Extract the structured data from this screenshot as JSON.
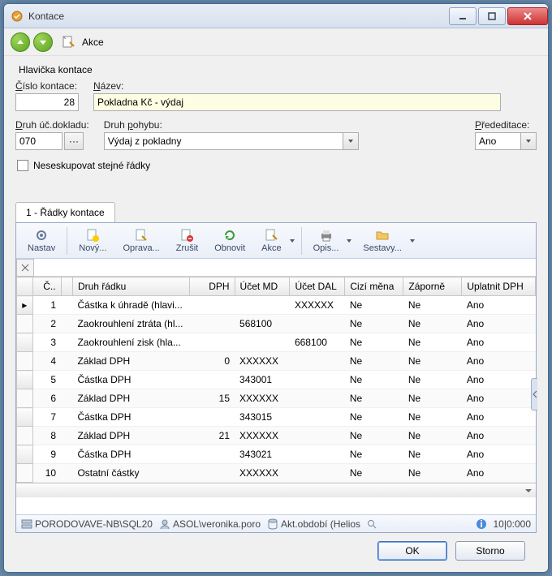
{
  "window": {
    "title": "Kontace"
  },
  "win_btns": {
    "min": "minimize",
    "max": "maximize",
    "close": "close"
  },
  "topbar": {
    "akce": "Akce"
  },
  "header": {
    "section_title": "Hlavička kontace",
    "cislo_label": "Číslo kontace:",
    "cislo_value": "28",
    "nazev_label": "Název:",
    "nazev_value": "Pokladna Kč - výdaj",
    "druh_dokladu_label": "Druh úč.dokladu:",
    "druh_dokladu_value": "070",
    "druh_pohybu_label": "Druh pohybu:",
    "druh_pohybu_value": "Výdaj z pokladny",
    "prededitace_label": "Přededitace:",
    "prededitace_value": "Ano",
    "neseskupovat_label": "Neseskupovat stejné řádky"
  },
  "tabs": {
    "tab1": "1 - Řádky kontace"
  },
  "toolbar": {
    "nastav": "Nastav",
    "novy": "Nový...",
    "oprava": "Oprava...",
    "zrusit": "Zrušit",
    "obnovit": "Obnovit",
    "akce": "Akce",
    "opis": "Opis...",
    "sestavy": "Sestavy..."
  },
  "grid": {
    "columns": {
      "cislo": "Č..",
      "druh": "Druh řádku",
      "dph": "DPH",
      "md": "Účet MD",
      "dal": "Účet DAL",
      "cizi": "Cizí měna",
      "zaporne": "Záporně",
      "uplatnit": "Uplatnit DPH"
    },
    "rows": [
      {
        "c": "1",
        "druh": "Částka k úhradě (hlavi...",
        "dph": "",
        "md": "",
        "dal": "XXXXXX",
        "cizi": "Ne",
        "zap": "Ne",
        "upl": "Ano"
      },
      {
        "c": "2",
        "druh": "Zaokrouhlení ztráta (hl...",
        "dph": "",
        "md": "568100",
        "dal": "",
        "cizi": "Ne",
        "zap": "Ne",
        "upl": "Ano"
      },
      {
        "c": "3",
        "druh": "Zaokrouhlení zisk (hla...",
        "dph": "",
        "md": "",
        "dal": "668100",
        "cizi": "Ne",
        "zap": "Ne",
        "upl": "Ano"
      },
      {
        "c": "4",
        "druh": "Základ DPH",
        "dph": "0",
        "md": "XXXXXX",
        "dal": "",
        "cizi": "Ne",
        "zap": "Ne",
        "upl": "Ano"
      },
      {
        "c": "5",
        "druh": "Částka DPH",
        "dph": "",
        "md": "343001",
        "dal": "",
        "cizi": "Ne",
        "zap": "Ne",
        "upl": "Ano"
      },
      {
        "c": "6",
        "druh": "Základ DPH",
        "dph": "15",
        "md": "XXXXXX",
        "dal": "",
        "cizi": "Ne",
        "zap": "Ne",
        "upl": "Ano"
      },
      {
        "c": "7",
        "druh": "Částka DPH",
        "dph": "",
        "md": "343015",
        "dal": "",
        "cizi": "Ne",
        "zap": "Ne",
        "upl": "Ano"
      },
      {
        "c": "8",
        "druh": "Základ DPH",
        "dph": "21",
        "md": "XXXXXX",
        "dal": "",
        "cizi": "Ne",
        "zap": "Ne",
        "upl": "Ano"
      },
      {
        "c": "9",
        "druh": "Částka DPH",
        "dph": "",
        "md": "343021",
        "dal": "",
        "cizi": "Ne",
        "zap": "Ne",
        "upl": "Ano"
      },
      {
        "c": "10",
        "druh": "Ostatní částky",
        "dph": "",
        "md": "XXXXXX",
        "dal": "",
        "cizi": "Ne",
        "zap": "Ne",
        "upl": "Ano"
      }
    ]
  },
  "status": {
    "server": "PORODOVAVE-NB\\SQL20",
    "user": "ASOL\\veronika.poro",
    "period": "Akt.období (Helios",
    "counter": "10|0:000"
  },
  "footer": {
    "ok": "OK",
    "storno": "Storno"
  }
}
